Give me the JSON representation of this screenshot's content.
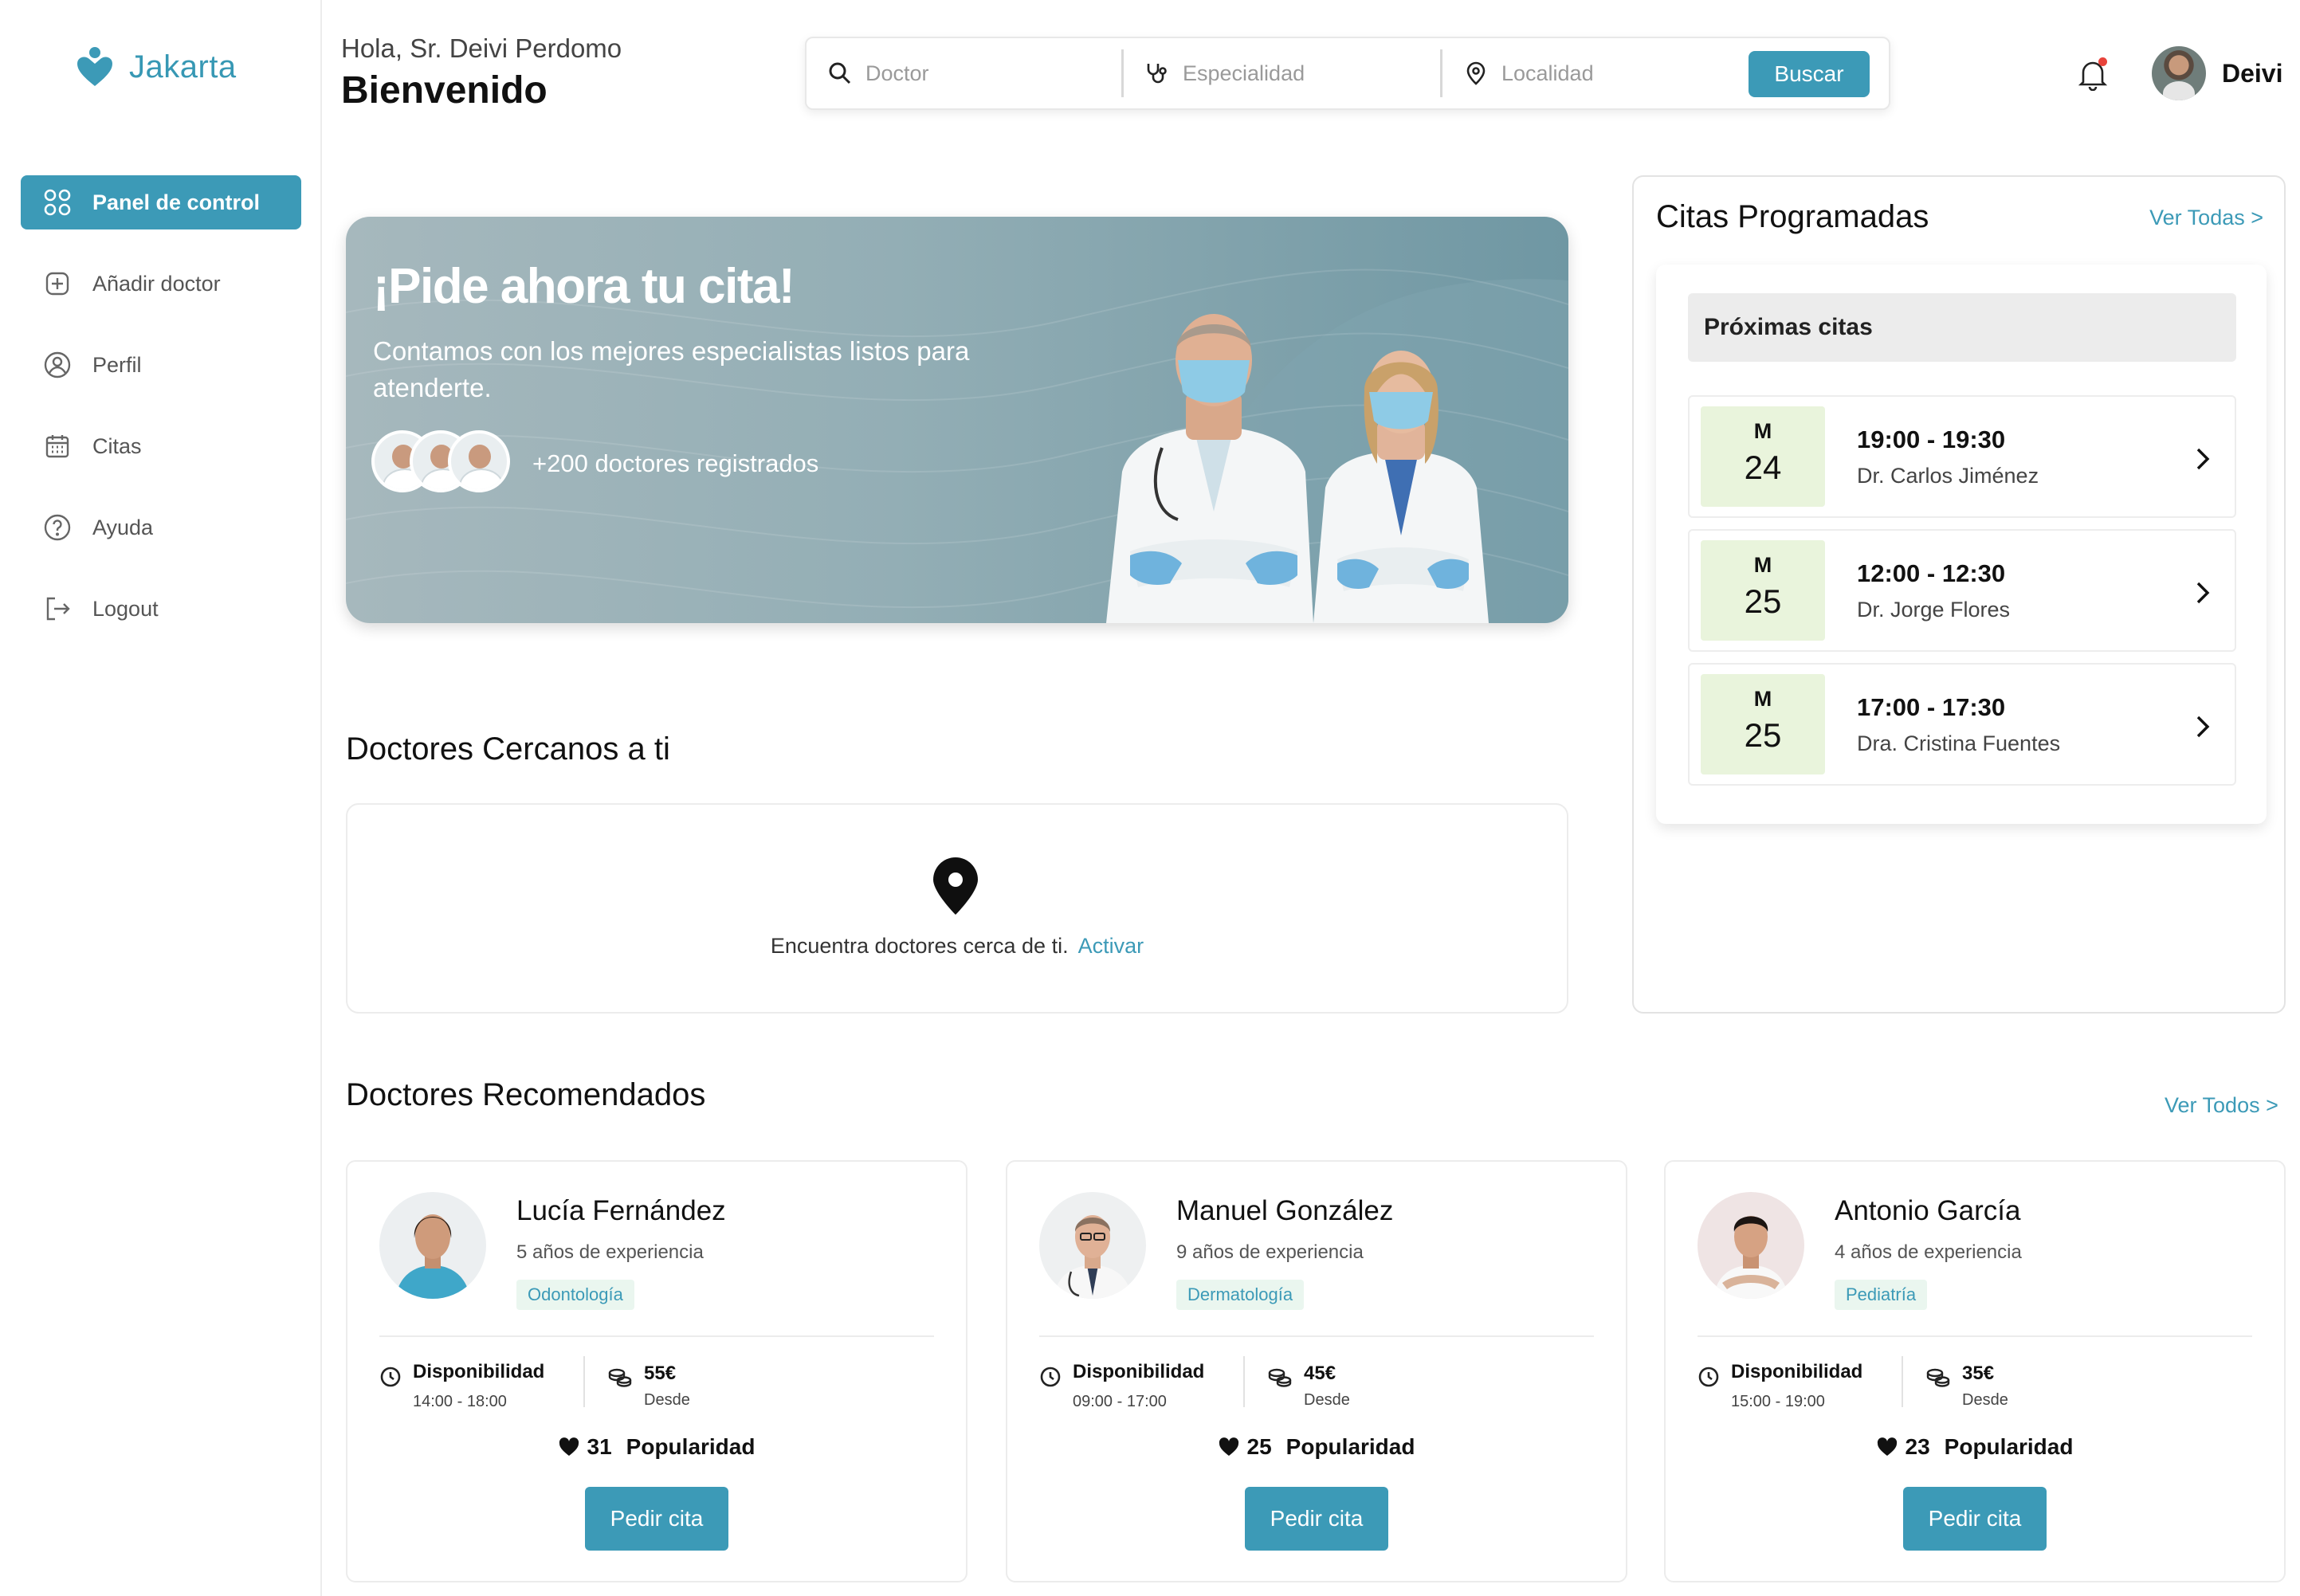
{
  "app": {
    "name": "Jakarta",
    "accent": "#3c9ab7"
  },
  "sidebar": {
    "items": [
      {
        "label": "Panel de control",
        "icon": "dashboard-icon",
        "active": true
      },
      {
        "label": "Añadir doctor",
        "icon": "add-square-icon"
      },
      {
        "label": "Perfil",
        "icon": "user-circle-icon"
      },
      {
        "label": "Citas",
        "icon": "calendar-icon"
      },
      {
        "label": "Ayuda",
        "icon": "help-circle-icon"
      },
      {
        "label": "Logout",
        "icon": "logout-icon"
      }
    ]
  },
  "header": {
    "hello": "Hola, Sr. Deivi Perdomo",
    "welcome": "Bienvenido",
    "search": {
      "doctor_placeholder": "Doctor",
      "specialty_placeholder": "Especialidad",
      "location_placeholder": "Localidad",
      "button": "Buscar"
    },
    "username": "Deivi"
  },
  "hero": {
    "title": "¡Pide ahora tu cita!",
    "subtitle": "Contamos con los mejores especialistas listos para atenderte.",
    "doctors_count": "+200 doctores registrados"
  },
  "nearby": {
    "title": "Doctores Cercanos a ti",
    "text": "Encuentra doctores cerca de ti.",
    "link": "Activar"
  },
  "appointments": {
    "title": "Citas Programadas",
    "see_all": "Ver Todas >",
    "upcoming_label": "Próximas citas",
    "items": [
      {
        "month": "M",
        "day": "24",
        "time": "19:00 - 19:30",
        "doctor": "Dr. Carlos Jiménez"
      },
      {
        "month": "M",
        "day": "25",
        "time": "12:00 - 12:30",
        "doctor": "Dr. Jorge Flores"
      },
      {
        "month": "M",
        "day": "25",
        "time": "17:00 - 17:30",
        "doctor": "Dra. Cristina Fuentes"
      }
    ]
  },
  "recommended": {
    "title": "Doctores Recomendados",
    "see_all": "Ver Todos >",
    "availability_label": "Disponibilidad",
    "from_label": "Desde",
    "popularity_label": "Popularidad",
    "book_button": "Pedir cita",
    "doctors": [
      {
        "name": "Lucía Fernández",
        "experience": "5 años de experiencia",
        "specialty": "Odontología",
        "hours": "14:00 - 18:00",
        "price": "55€",
        "likes": "31"
      },
      {
        "name": "Manuel González",
        "experience": "9 años de experiencia",
        "specialty": "Dermatología",
        "hours": "09:00 - 17:00",
        "price": "45€",
        "likes": "25"
      },
      {
        "name": "Antonio García",
        "experience": "4 años de experiencia",
        "specialty": "Pediatría",
        "hours": "15:00 - 19:00",
        "price": "35€",
        "likes": "23"
      }
    ]
  }
}
